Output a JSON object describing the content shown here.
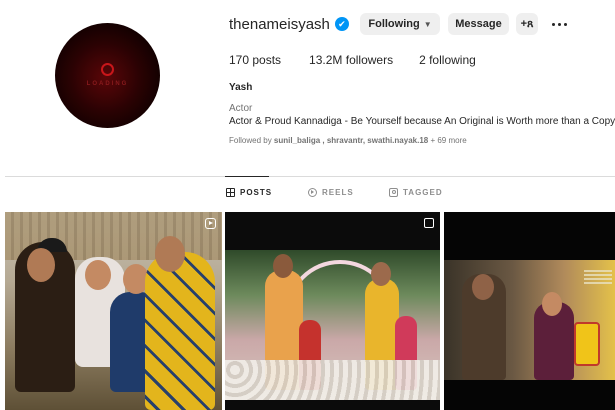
{
  "profile": {
    "avatar_text": "LOADING",
    "username": "thenameisyash",
    "verified_mark": "✔",
    "following_label": "Following",
    "message_label": "Message",
    "suggest_icon": "person-add-icon",
    "more_icon": "more-options-icon"
  },
  "stats": {
    "posts": "170 posts",
    "followers": "13.2M followers",
    "following": "2 following"
  },
  "bio": {
    "name": "Yash",
    "category": "Actor",
    "text": "Actor & Proud Kannadiga - Be Yourself because An Original is Worth more than a Copy",
    "followed_by_prefix": "Followed by ",
    "followed_by_users": "sunil_baliga , shravantr, swathi.nayak.18",
    "followed_by_suffix": " + 69 more"
  },
  "tabs": [
    {
      "label": "POSTS",
      "icon": "grid-icon",
      "active": true
    },
    {
      "label": "REELS",
      "icon": "reels-icon",
      "active": false
    },
    {
      "label": "TAGGED",
      "icon": "tagged-icon",
      "active": false
    }
  ],
  "posts": [
    {
      "badge": "reel-icon"
    },
    {
      "badge": "multiple-photos-icon"
    },
    {
      "badge": "none"
    }
  ],
  "colors": {
    "accent": "#0095f6",
    "button_bg": "#efefef",
    "muted_text": "#737373"
  }
}
